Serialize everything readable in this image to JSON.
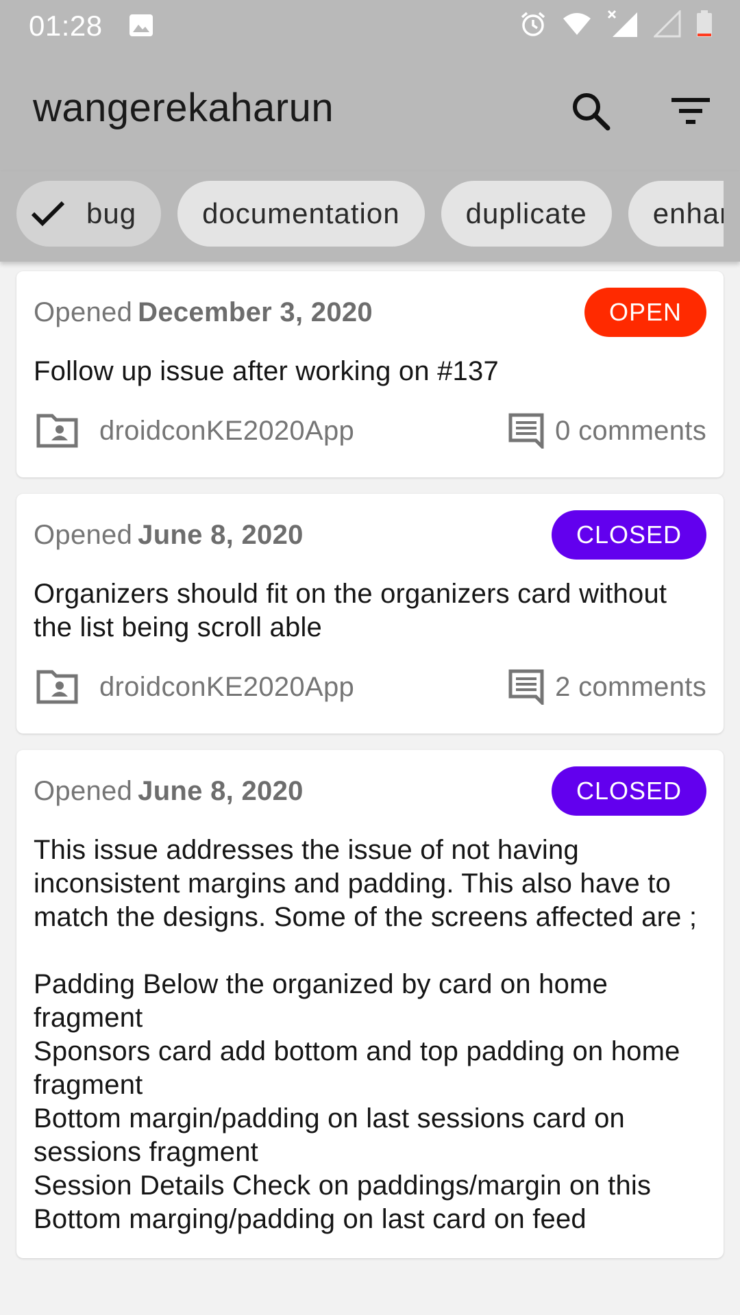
{
  "status_bar": {
    "time": "01:28",
    "icons": [
      "image-icon",
      "alarm-icon",
      "wifi-icon",
      "signal-no-data-icon",
      "signal-icon",
      "battery-low-icon"
    ]
  },
  "app_bar": {
    "title": "wangerekaharun",
    "actions": [
      "search-icon",
      "filter-icon"
    ]
  },
  "chips": [
    {
      "label": "bug",
      "selected": true
    },
    {
      "label": "documentation",
      "selected": false
    },
    {
      "label": "duplicate",
      "selected": false
    },
    {
      "label": "enhancement",
      "selected": false
    }
  ],
  "issues": [
    {
      "opened_prefix": "Opened",
      "date": "December 3, 2020",
      "status": "OPEN",
      "title": "Follow up issue after working on #137",
      "repo": "droidconKE2020App",
      "comments": "0 comments"
    },
    {
      "opened_prefix": "Opened",
      "date": "June 8, 2020",
      "status": "CLOSED",
      "title": "Organizers should fit on the organizers card without the list being scroll able",
      "repo": "droidconKE2020App",
      "comments": "2 comments"
    },
    {
      "opened_prefix": "Opened",
      "date": "June 8, 2020",
      "status": "CLOSED",
      "title": "This issue addresses the issue of not having inconsistent margins and padding. This also have to match the designs. Some of the screens affected are ;\n\nPadding Below the organized by card on home fragment\nSponsors card add bottom and top padding on home fragment\nBottom margin/padding on last sessions card on sessions fragment\nSession Details Check on paddings/margin on this\nBottom marging/padding on last card on feed",
      "repo": "droidconKE2020App",
      "comments": ""
    }
  ],
  "colors": {
    "bar_background": "#b9b9b9",
    "open_badge": "#ff2a00",
    "closed_badge": "#6200ee"
  }
}
